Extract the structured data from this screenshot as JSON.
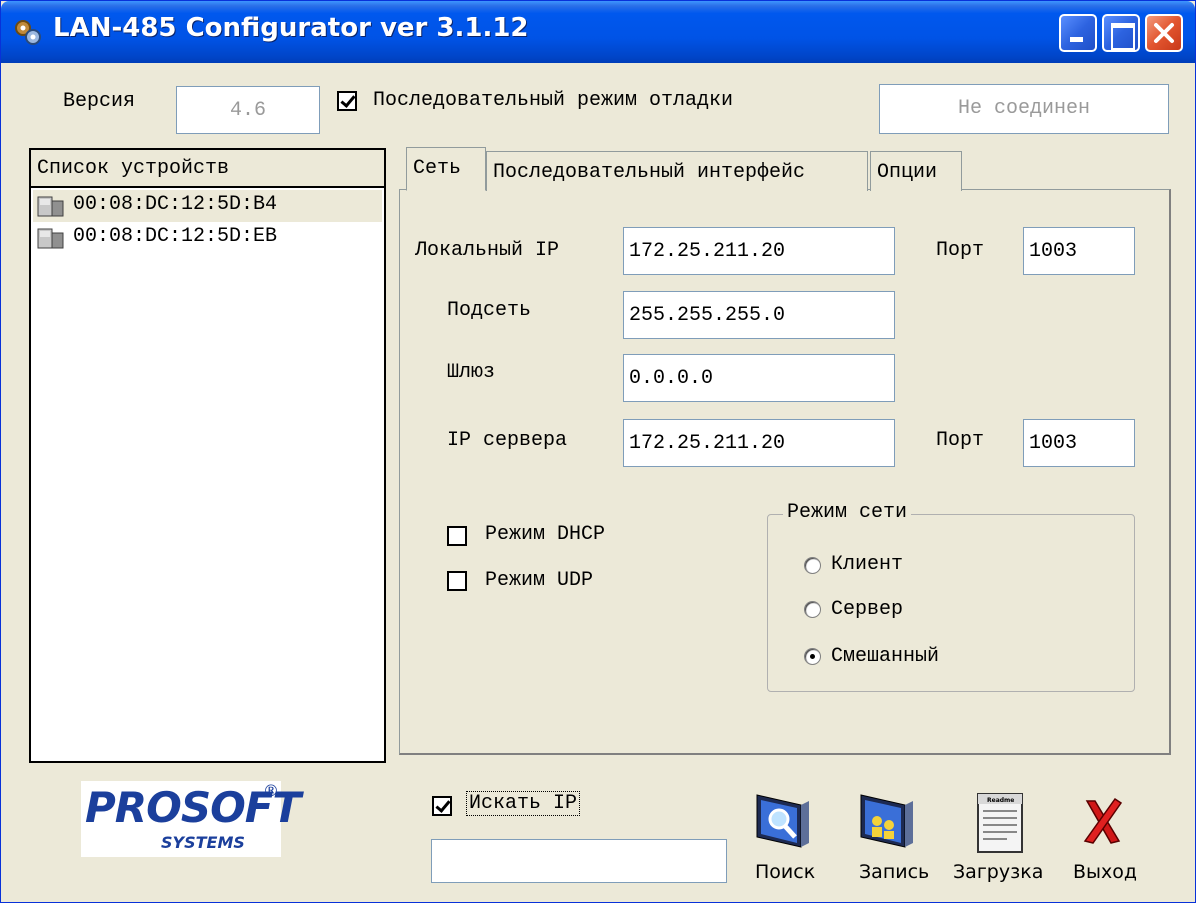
{
  "window": {
    "title": "LAN-485 Configurator ver 3.1.12"
  },
  "header": {
    "version_label": "Версия",
    "version_value": "4.6",
    "debug_label": "Последовательный режим отладки",
    "debug_checked": true,
    "status_value": "Не соединен"
  },
  "device_list": {
    "header": "Список устройств",
    "items": [
      {
        "label": "00:08:DC:12:5D:B4",
        "selected": true
      },
      {
        "label": "00:08:DC:12:5D:EB",
        "selected": false
      }
    ]
  },
  "tabs": [
    {
      "label": "Сеть",
      "active": true
    },
    {
      "label": "Последовательный интерфейс",
      "active": false
    },
    {
      "label": "Опции",
      "active": false
    }
  ],
  "network": {
    "local_ip_label": "Локальный IP",
    "local_ip": "172.25.211.20",
    "port_label": "Порт",
    "local_port": "1003",
    "subnet_label": "Подсеть",
    "subnet": "255.255.255.0",
    "gateway_label": "Шлюз",
    "gateway": "0.0.0.0",
    "server_ip_label": "IP сервера",
    "server_ip": "172.25.211.20",
    "server_port_label": "Порт",
    "server_port": "1003",
    "dhcp_label": "Режим DHCP",
    "udp_label": "Режим UDP",
    "mode_group": {
      "title": "Режим сети",
      "options": [
        {
          "label": "Клиент",
          "selected": false
        },
        {
          "label": "Сервер",
          "selected": false
        },
        {
          "label": "Смешанный",
          "selected": true
        }
      ]
    }
  },
  "footer": {
    "logo_main": "ProSoft",
    "logo_sub": "SYSTEMS",
    "search_ip_label": "Искать IP",
    "search_ip_checked": true,
    "search_input_value": "",
    "buttons": {
      "search": "Поиск",
      "write": "Запись",
      "load": "Загрузка",
      "exit": "Выход"
    },
    "readme_text": "Readme"
  },
  "colors": {
    "titlebar": "#0053E6",
    "face": "#ECE9D8",
    "close": "#E2552F",
    "logo_blue": "#1B3F9C"
  },
  "icons": [
    "gear-app-icon",
    "device-icon",
    "search-monitor-icon",
    "write-monitor-icon",
    "readme-document-icon",
    "exit-x-icon"
  ]
}
